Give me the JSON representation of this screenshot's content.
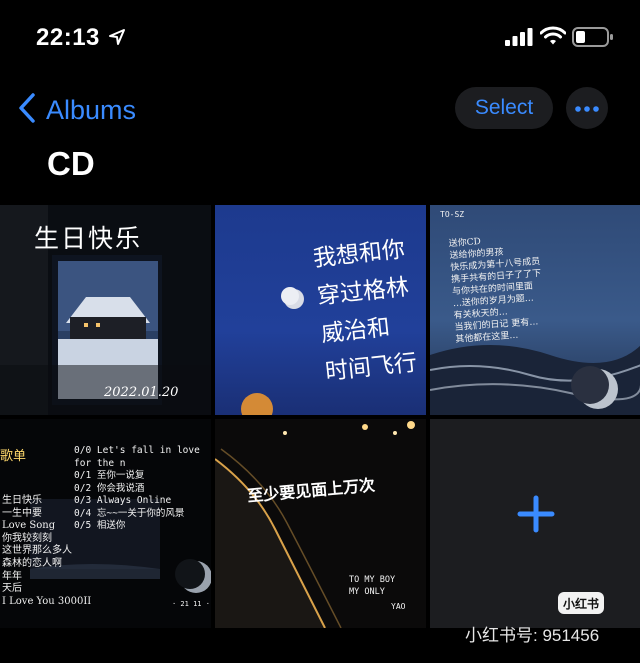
{
  "status_bar": {
    "time": "22:13"
  },
  "nav": {
    "back_label": "Albums",
    "select_label": "Select"
  },
  "album": {
    "title": "CD"
  },
  "tiles": [
    {
      "text": "生日快乐",
      "date": "2022.01.20"
    },
    {
      "lines": [
        "我想和你",
        "穿过格林",
        "威治和",
        "时间飞行"
      ]
    },
    {
      "header": "TO-SZ",
      "lines": [
        "送你CD",
        "送给你的男孩",
        "快乐成为第十八号成员",
        "携手共有的日子了了下",
        "与你共在的时间里面",
        "…送你的岁月为题…",
        "有关秋天的…",
        "当我们的日记 更有…",
        "其他都在这里…"
      ]
    },
    {
      "header": "歌单",
      "tracks": [
        "0/0  Let's fall in love for the n",
        "0/1  至你一说复",
        "0/2  你会我说酒",
        "0/3  Always Online",
        "0/4  忘~~一关于你的风景",
        "0/5  相送你"
      ],
      "left_lines": [
        "生日快乐",
        "一生中要",
        "Love Song",
        "你我较刻刻",
        "这世界那么多人",
        "森林的恋人啊",
        "年年",
        "天后",
        "I Love You 3000II"
      ],
      "footer": "· 21 11 ·"
    },
    {
      "text": "至少要见面上万次",
      "sign": [
        "TO MY BOY",
        "MY ONLY"
      ],
      "sign_by": "YAO"
    }
  ],
  "add_tile": {
    "icon": "plus-icon"
  },
  "watermark": {
    "badge": "小红书",
    "text": "小红书号: 951456"
  },
  "colors": {
    "accent": "#3a8bff",
    "background": "#000000",
    "button_bg": "#1c1d20"
  }
}
